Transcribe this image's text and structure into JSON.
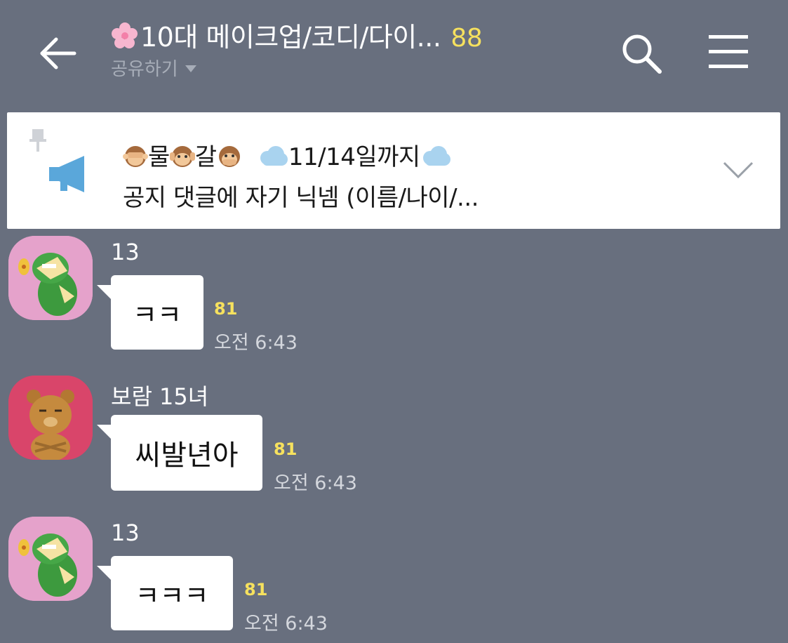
{
  "header": {
    "title": "10대 메이크업/코디/다이...",
    "member_count": "88",
    "share_label": "공유하기"
  },
  "notice": {
    "line1_word1": "물",
    "line1_word2": "갈",
    "line1_text": "11/14일까지",
    "line2": "공지 댓글에 자기 닉넴 (이름/나이/..."
  },
  "messages": [
    {
      "sender": "13",
      "text": "ㅋㅋ",
      "unread": "81",
      "time": "오전 6:43",
      "avatar": "green-dino-avatar"
    },
    {
      "sender": "보람 15녀",
      "text": "씨발년아",
      "unread": "81",
      "time": "오전 6:43",
      "avatar": "bear-avatar"
    },
    {
      "sender": "13",
      "text": "ㅋㅋㅋ",
      "unread": "81",
      "time": "오전 6:43",
      "avatar": "green-dino-avatar"
    }
  ],
  "colors": {
    "background": "#686f7e",
    "accent_yellow": "#f6e15e",
    "bubble": "#ffffff"
  }
}
